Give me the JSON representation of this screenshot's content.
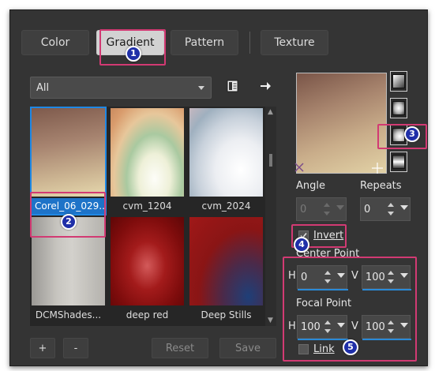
{
  "tabs": [
    "Color",
    "Gradient",
    "Pattern",
    "Texture"
  ],
  "active_tab": "Gradient",
  "category": {
    "selected": "All"
  },
  "swatches": [
    {
      "label": "Corel_06_029...",
      "selected": true
    },
    {
      "label": "cvm_1204"
    },
    {
      "label": "cvm_2024"
    },
    {
      "label": "DCMShades..."
    },
    {
      "label": "deep red"
    },
    {
      "label": "Deep Stills"
    }
  ],
  "buttons": {
    "add": "+",
    "remove": "-",
    "reset": "Reset",
    "save": "Save"
  },
  "angle": {
    "label": "Angle",
    "value": "0"
  },
  "repeats": {
    "label": "Repeats",
    "value": "0"
  },
  "invert": {
    "label": "Invert",
    "checked": true
  },
  "center_point": {
    "label": "Center Point",
    "h_label": "H",
    "h": "0",
    "v_label": "V",
    "v": "100"
  },
  "focal_point": {
    "label": "Focal Point",
    "h_label": "H",
    "h": "100",
    "v_label": "V",
    "v": "100"
  },
  "link": {
    "label": "Link",
    "checked": false
  },
  "annotations": [
    "1",
    "2",
    "3",
    "4",
    "5"
  ],
  "colors": {
    "accent": "#1e73c8",
    "highlight": "#d23a73",
    "badge": "#1f2fa8"
  }
}
